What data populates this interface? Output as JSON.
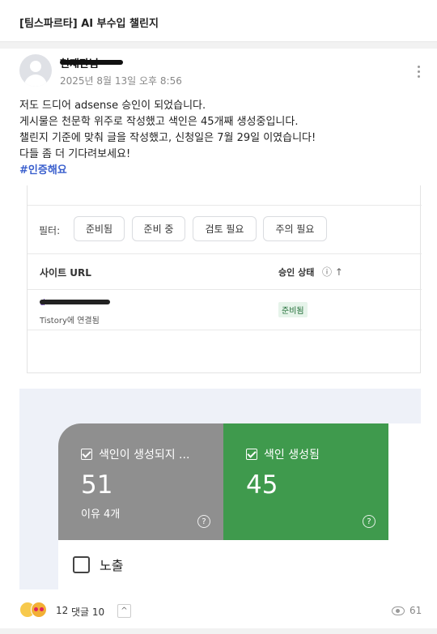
{
  "header": {
    "title": "[팀스파르타] AI 부수입 챌린지"
  },
  "post": {
    "author": "현재판님",
    "date": "2025년 8월 13일 오후 8:56",
    "lines": [
      "저도 드디어 adsense 승인이 되었습니다.",
      "게시물은 천문학 위주로 작성했고 색인은 45개째 생성중입니다.",
      "챌린지 기준에 맞춰 글을 작성했고, 신청일은 7월 29일 이였습니다!",
      "다들 좀 더 기다려보세요!"
    ],
    "hashtag": "#인증해요"
  },
  "adsense_shot": {
    "filter_label": "필터:",
    "chips": [
      "준비됨",
      "준비 중",
      "검토 필요",
      "주의 필요"
    ],
    "col_site_url": "사이트 URL",
    "col_status": "승인 상태",
    "status_icons": "ⓘ ↑",
    "row": {
      "url": "d",
      "connected": "Tistory에 연결됨",
      "status": "준비됨"
    }
  },
  "index_shot": {
    "not_indexed": {
      "label": "색인이 생성되지 ...",
      "value": "51",
      "reason": "이유 4개"
    },
    "indexed": {
      "label": "색인 생성됨",
      "value": "45"
    },
    "help_glyph": "?",
    "impressions_label": "노출"
  },
  "footer": {
    "reaction_count": "12",
    "comments": "댓글 10",
    "expand_glyph": "^",
    "views": "61"
  },
  "colors": {
    "indexed_green": "#3f9a4d",
    "not_indexed_grey": "#8f8f8f",
    "hashtag_blue": "#3a5fcd"
  }
}
